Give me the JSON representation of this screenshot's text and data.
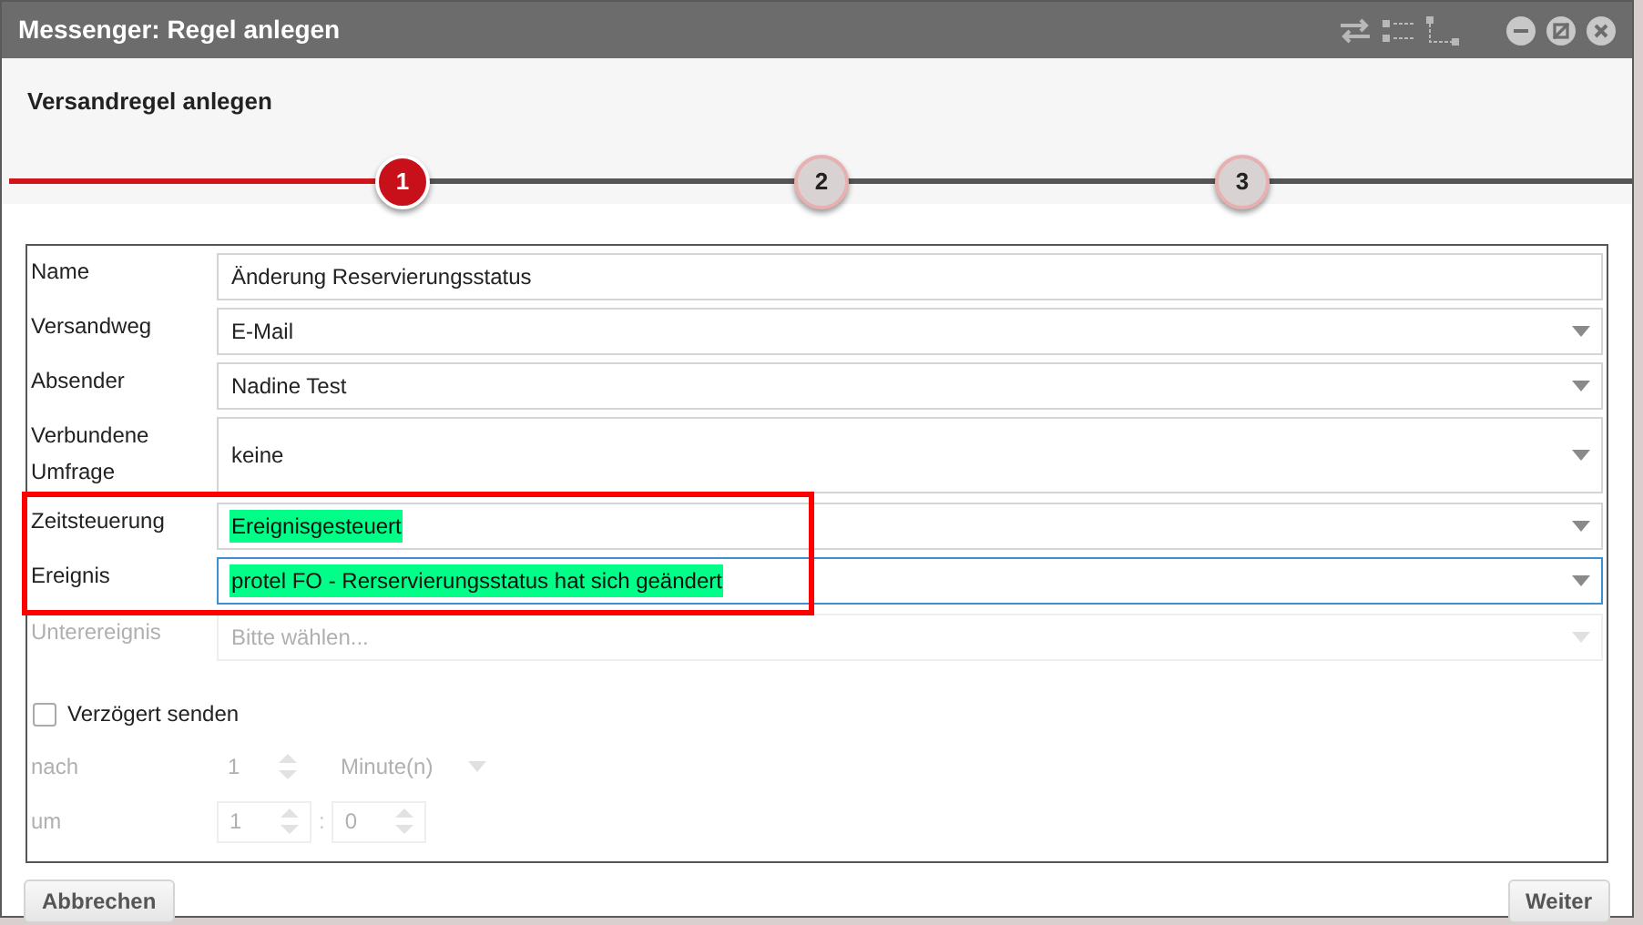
{
  "window": {
    "title": "Messenger: Regel anlegen"
  },
  "header": {
    "title": "Versandregel anlegen"
  },
  "steps": [
    {
      "label": "1",
      "selected": true
    },
    {
      "label": "2",
      "selected": false
    },
    {
      "label": "3",
      "selected": false
    }
  ],
  "form": {
    "rows": [
      {
        "label": "Name",
        "kind": "text",
        "value": "Änderung Reservierungsstatus",
        "highlighted": false,
        "focused": false,
        "disabled": false,
        "marked": false
      },
      {
        "label": "Versandweg",
        "kind": "select",
        "value": "E-Mail",
        "highlighted": false,
        "focused": false,
        "disabled": false,
        "marked": false
      },
      {
        "label": "Absender",
        "kind": "select",
        "value": "Nadine Test",
        "highlighted": false,
        "focused": false,
        "disabled": false,
        "marked": false
      },
      {
        "label": "Verbundene Umfrage",
        "kind": "select",
        "value": "keine",
        "highlighted": false,
        "focused": false,
        "disabled": false,
        "marked": false
      },
      {
        "label": "Zeitsteuerung",
        "kind": "select",
        "value": "Ereignisgesteuert",
        "highlighted": true,
        "focused": false,
        "disabled": false,
        "marked": true
      },
      {
        "label": "Ereignis",
        "kind": "select",
        "value": "protel FO - Rerservierungsstatus hat sich geändert",
        "highlighted": true,
        "focused": true,
        "disabled": false,
        "marked": true
      },
      {
        "label": "Unterereignis",
        "kind": "select",
        "placeholder": "Bitte wählen...",
        "highlighted": false,
        "focused": false,
        "disabled": true,
        "marked": false
      }
    ],
    "delay": {
      "label": "Verzögert senden",
      "checked": false,
      "after": {
        "label": "nach",
        "value": "1",
        "unit": "Minute(n)",
        "disabled": true
      },
      "at": {
        "label": "um",
        "hours": "1",
        "separator": ":",
        "minutes": "0",
        "disabled": true
      }
    }
  },
  "buttons": [
    {
      "label": "Abbrechen"
    },
    {
      "label": "Weiter"
    }
  ]
}
